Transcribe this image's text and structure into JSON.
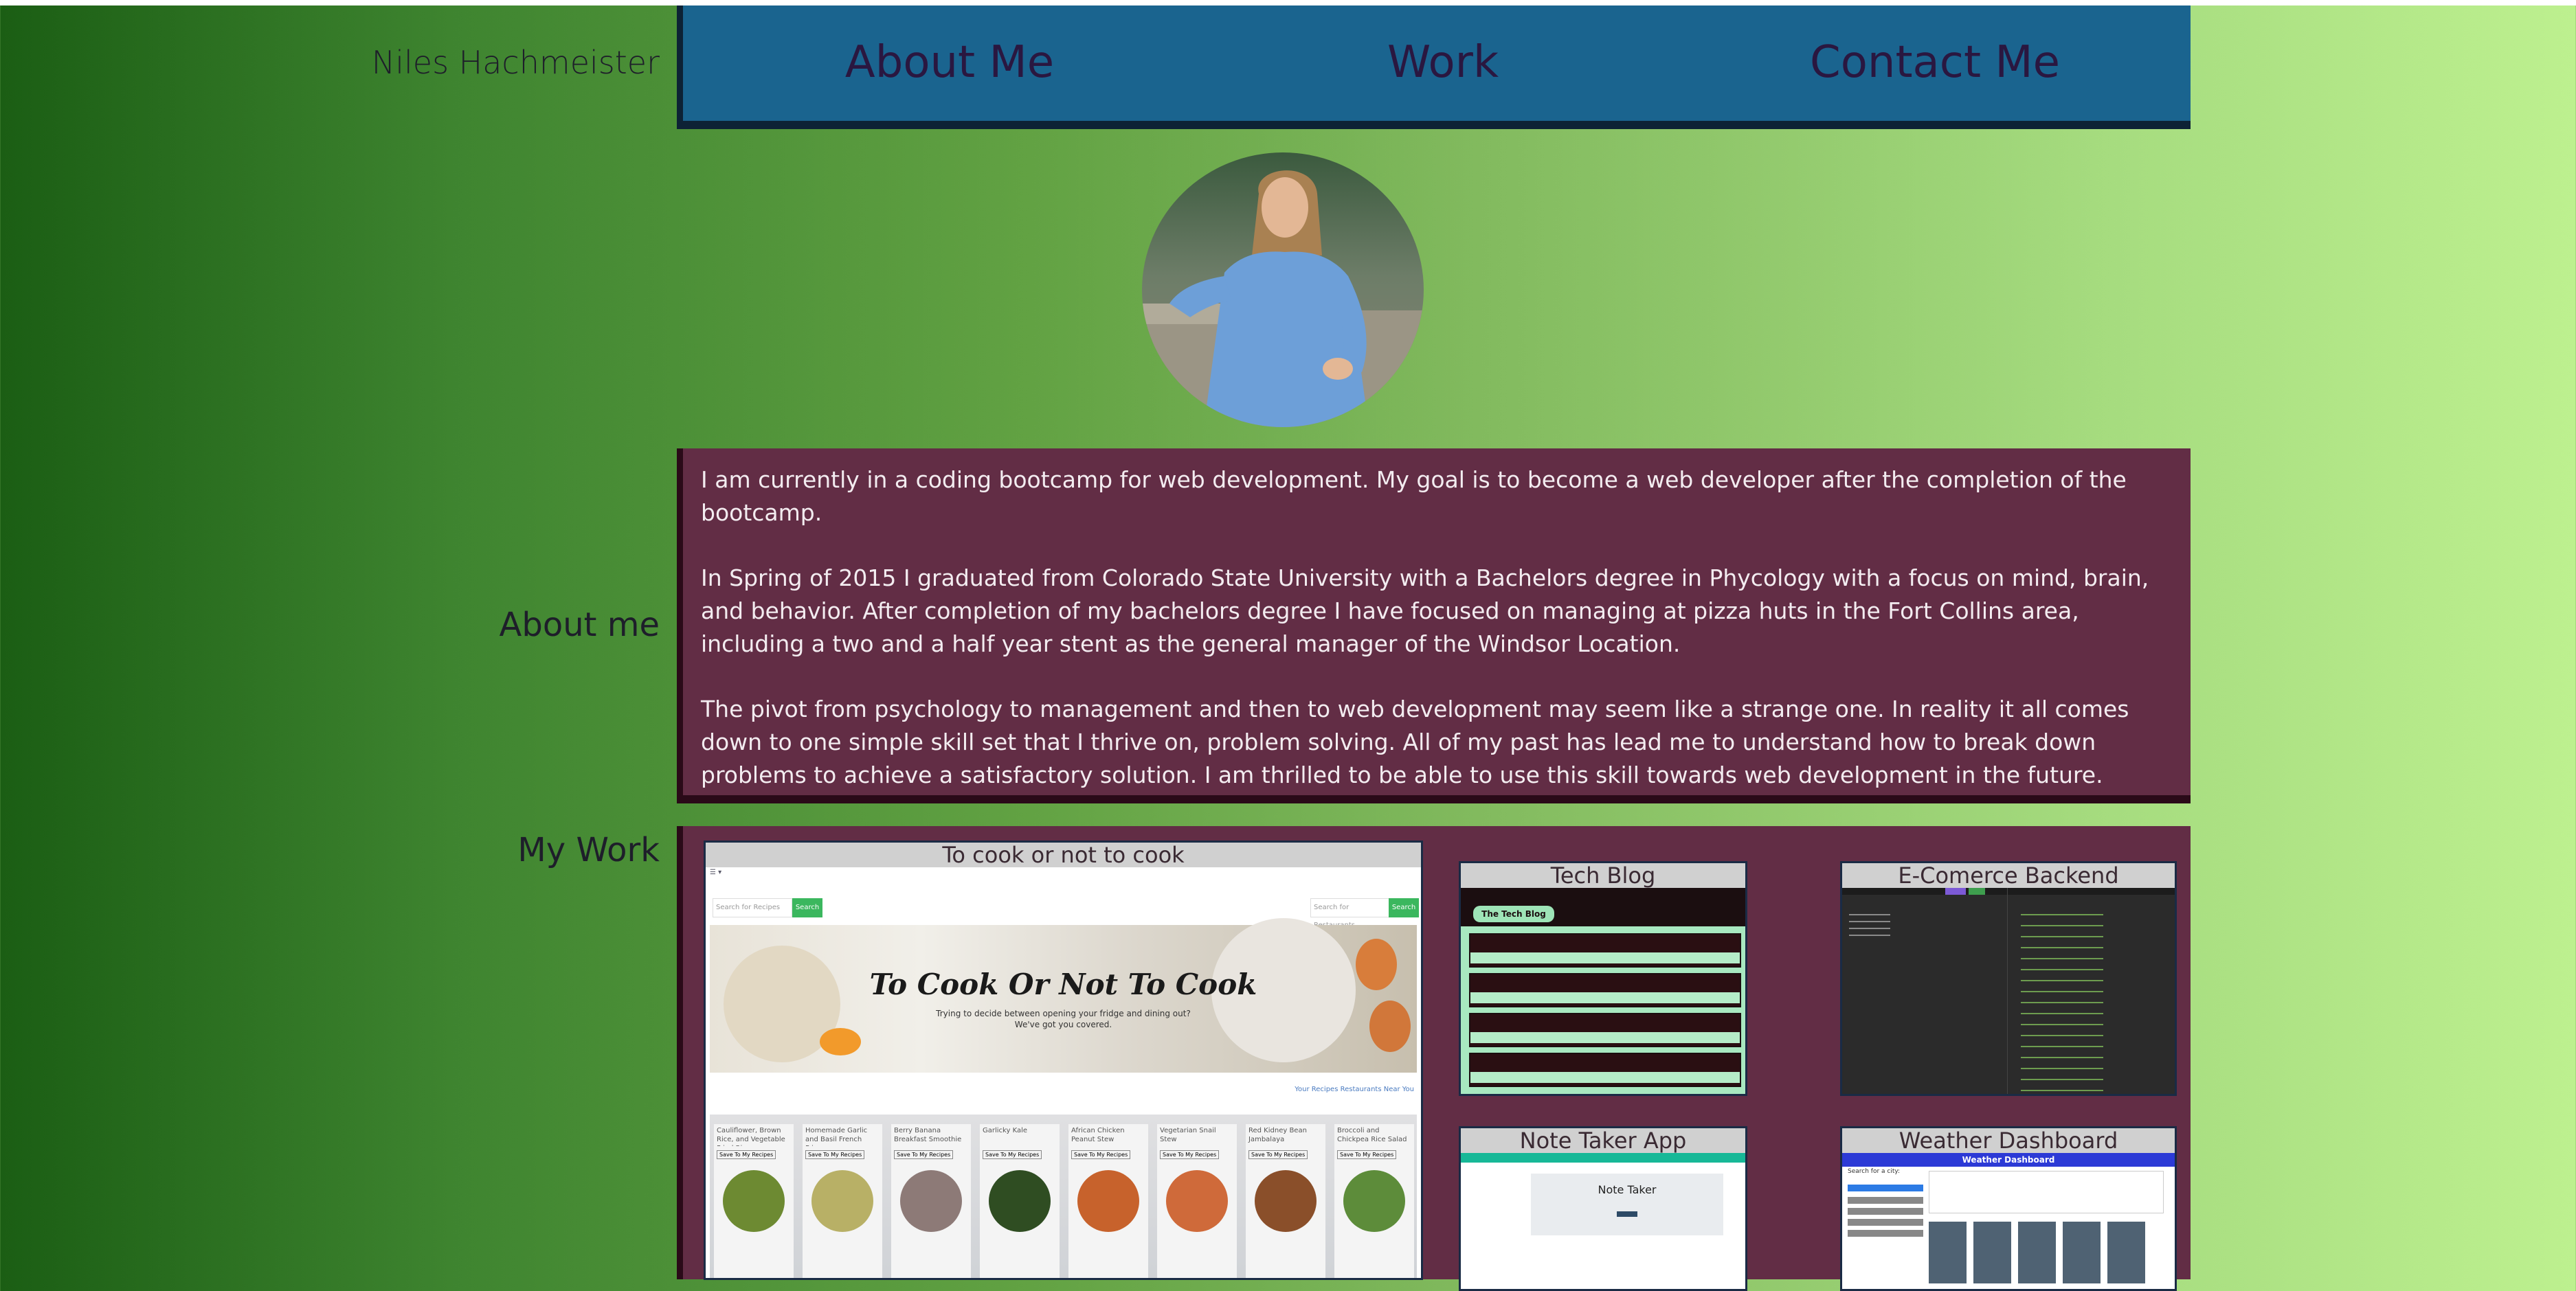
{
  "header": {
    "name": "Niles Hachmeister"
  },
  "nav": {
    "items": [
      "About Me",
      "Work",
      "Contact Me"
    ]
  },
  "about": {
    "label": "About me",
    "paragraphs": [
      "I am currently in a coding bootcamp for web development. My goal is to become a web developer after the completion of the bootcamp.",
      "In Spring of 2015 I graduated from Colorado State University with a Bachelors degree in Phycology with a focus on mind, brain, and behavior. After completion of my bachelors degree I have focused on managing at pizza huts in the Fort Collins area, including a two and a half year stent as the general manager of the Windsor Location.",
      "The pivot from psychology to management and then to web development may seem like a strange one. In reality it all comes down to one simple skill set that I thrive on, problem solving. All of my past has lead me to understand how to break down problems to achieve a satisfactory solution. I am thrilled to be able to use this skill towards web development in the future."
    ]
  },
  "work": {
    "label": "My Work",
    "projects": [
      {
        "title": "To cook or not to cook"
      },
      {
        "title": "Tech Blog"
      },
      {
        "title": "E-Comerce Backend"
      },
      {
        "title": "Note Taker App"
      },
      {
        "title": "Weather Dashboard"
      }
    ],
    "cook": {
      "hero_title": "To Cook Or Not To Cook",
      "hero_sub1": "Trying to decide between opening your fridge and dining out?",
      "hero_sub2": "We've got you covered.",
      "search_placeholder": "Search for Recipes",
      "search_btn": "Search",
      "search_restaurants": "Search for Restaurants",
      "links": "Your Recipes   Restaurants Near You",
      "recipes": [
        "Cauliflower, Brown Rice, and Vegetable Fried Rice",
        "Homemade Garlic and Basil French Fries",
        "Berry Banana Breakfast Smoothie",
        "Garlicky Kale",
        "African Chicken Peanut Stew",
        "Vegetarian Snail Stew",
        "Red Kidney Bean Jambalaya",
        "Broccoli and Chickpea Rice Salad"
      ],
      "save_label": "Save To My Recipes"
    },
    "techblog": {
      "heading": "The Tech Blog"
    },
    "notetaker": {
      "heading": "Note Taker"
    },
    "weather": {
      "heading": "Weather Dashboard",
      "search_label": "Search for a city:"
    }
  },
  "colors": {
    "nav_bg": "#1a648f",
    "panel_bg": "#622d45",
    "panel_border": "#2a0a18"
  }
}
